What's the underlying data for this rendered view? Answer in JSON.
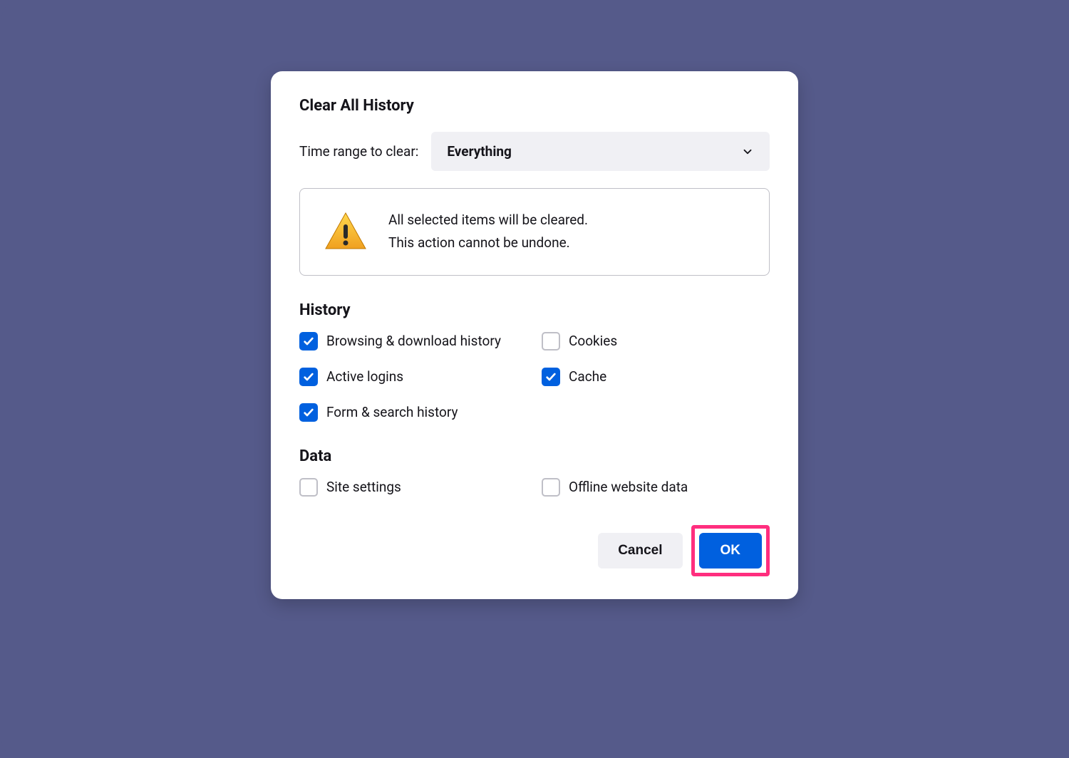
{
  "dialog": {
    "title": "Clear All History",
    "time_range": {
      "label": "Time range to clear:",
      "selected": "Everything"
    },
    "warning": {
      "line1": "All selected items will be cleared.",
      "line2": "This action cannot be undone."
    },
    "sections": {
      "history": {
        "title": "History",
        "items": [
          {
            "label": "Browsing & download history",
            "checked": true
          },
          {
            "label": "Cookies",
            "checked": false
          },
          {
            "label": "Active logins",
            "checked": true
          },
          {
            "label": "Cache",
            "checked": true
          },
          {
            "label": "Form & search history",
            "checked": true
          }
        ]
      },
      "data": {
        "title": "Data",
        "items": [
          {
            "label": "Site settings",
            "checked": false
          },
          {
            "label": "Offline website data",
            "checked": false
          }
        ]
      }
    },
    "buttons": {
      "cancel": "Cancel",
      "ok": "OK"
    }
  }
}
